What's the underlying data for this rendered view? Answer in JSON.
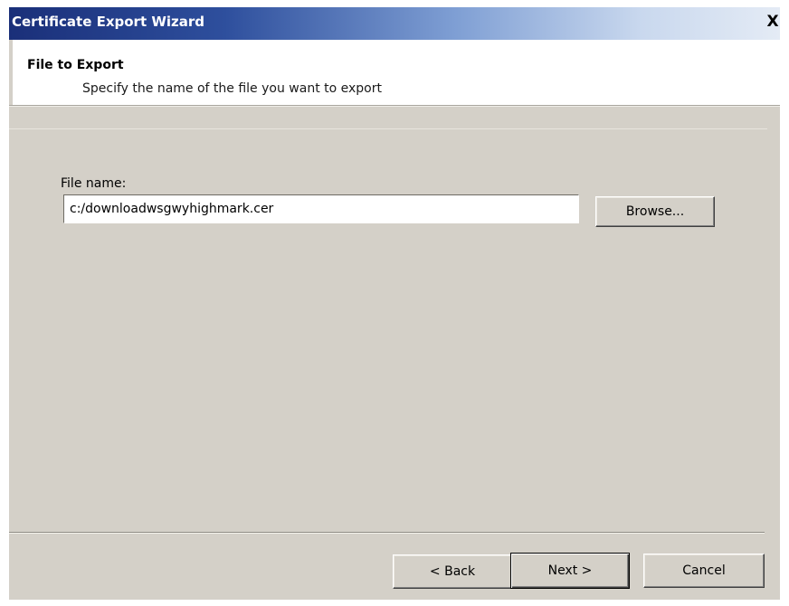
{
  "window": {
    "title": "Certificate Export Wizard",
    "close_glyph": "X"
  },
  "header": {
    "title": "File to Export",
    "subtitle": "Specify the name of the file you want to export"
  },
  "form": {
    "file_name_label": "File name:",
    "file_name_value": "c:/downloadwsgwyhighmark.cer"
  },
  "buttons": {
    "browse": "Browse...",
    "back": "< Back",
    "next": "Next >",
    "cancel": "Cancel"
  },
  "colors": {
    "title_bar_start": "#1a2f79",
    "title_bar_end": "#e4ebf5",
    "dialog_face": "#d4d0c8",
    "header_background": "#ffffff"
  },
  "icons": {
    "close": "close-icon"
  }
}
